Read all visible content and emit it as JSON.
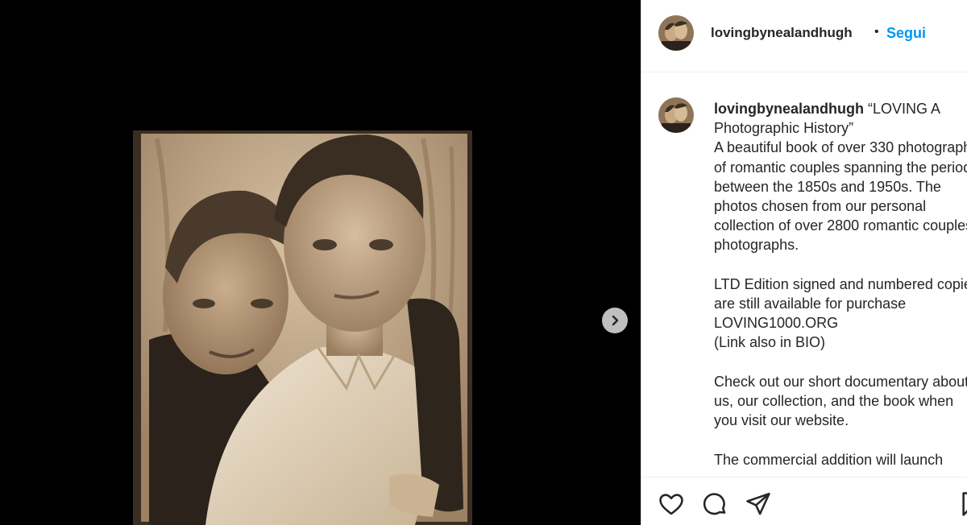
{
  "post": {
    "username": "lovingbynealandhugh",
    "dot": "•",
    "follow_label": "Segui",
    "photo_alt": "Vintage sepia photo-booth portrait of two young men posing cheek to cheek",
    "caption_user": "lovingbynealandhugh",
    "caption_text": " “LOVING A Photographic History”\nA beautiful book of over 330 photographs of romantic couples spanning the period between the 1850s and 1950s. The photos chosen from our personal collection of over 2800 romantic couples photographs.\n\nLTD Edition signed and numbered copies are still available for purchase LOVING1000.ORG\n(Link also in BIO)\n\nCheck out our short documentary about us, our collection, and the book when you visit our website.\n\nThe commercial addition will launch"
  },
  "icons": {
    "like": "heart-icon",
    "comment": "comment-icon",
    "share": "share-icon",
    "save": "bookmark-icon",
    "next": "chevron-right-icon"
  },
  "colors": {
    "accent": "#0095f6",
    "text": "#262626",
    "media_bg": "#000000",
    "sepia": "#b59a7a"
  }
}
